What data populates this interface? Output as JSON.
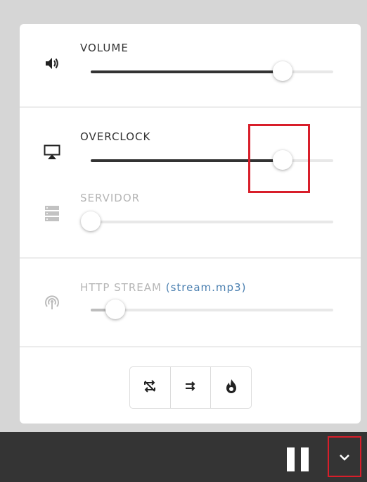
{
  "volume": {
    "label": "VOLUME",
    "value_fraction": 0.79,
    "icon": "speaker-icon"
  },
  "overclock": {
    "label": "OVERCLOCK",
    "value_fraction": 0.79,
    "icon": "airplay-icon"
  },
  "servidor": {
    "label": "SERVIDOR",
    "value_fraction": 0.0,
    "icon": "server-icon"
  },
  "http_stream": {
    "label": "HTTP STREAM",
    "link": "(stream.mp3)",
    "value_fraction": 0.1,
    "icon": "broadcast-icon"
  },
  "mode_buttons": [
    {
      "icon": "repeat-off-icon"
    },
    {
      "icon": "sequential-icon"
    },
    {
      "icon": "flame-icon"
    }
  ],
  "player_bar": {
    "pause_icon": "pause-icon",
    "collapse_icon": "chevron-down-icon"
  },
  "colors": {
    "accent_highlight": "#d81e2a",
    "link": "#4a7fb0",
    "bar_background": "#343434"
  }
}
